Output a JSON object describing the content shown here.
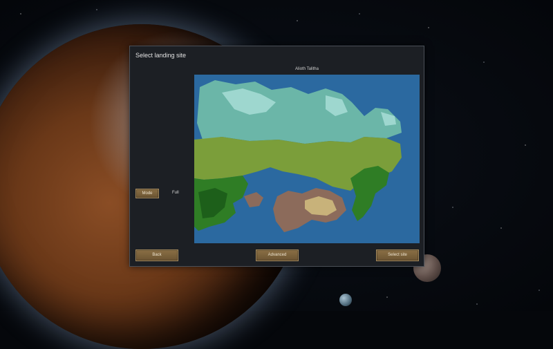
{
  "dialog": {
    "title": "Select landing site",
    "map_title": "Alioth Talitha",
    "mode_label": "Mode",
    "mode_value": "Full",
    "back_label": "Back",
    "advanced_label": "Advanced",
    "select_label": "Select site"
  },
  "colors": {
    "ocean": "#2b69a0",
    "tundra": "#6bb6a8",
    "ice": "#9ed7cf",
    "grassland": "#7b9e3a",
    "forest": "#2f7d25",
    "jungle": "#1d5f1a",
    "desert": "#c8b27a",
    "mountain": "#8c6b5b",
    "button": "#7a6340"
  }
}
